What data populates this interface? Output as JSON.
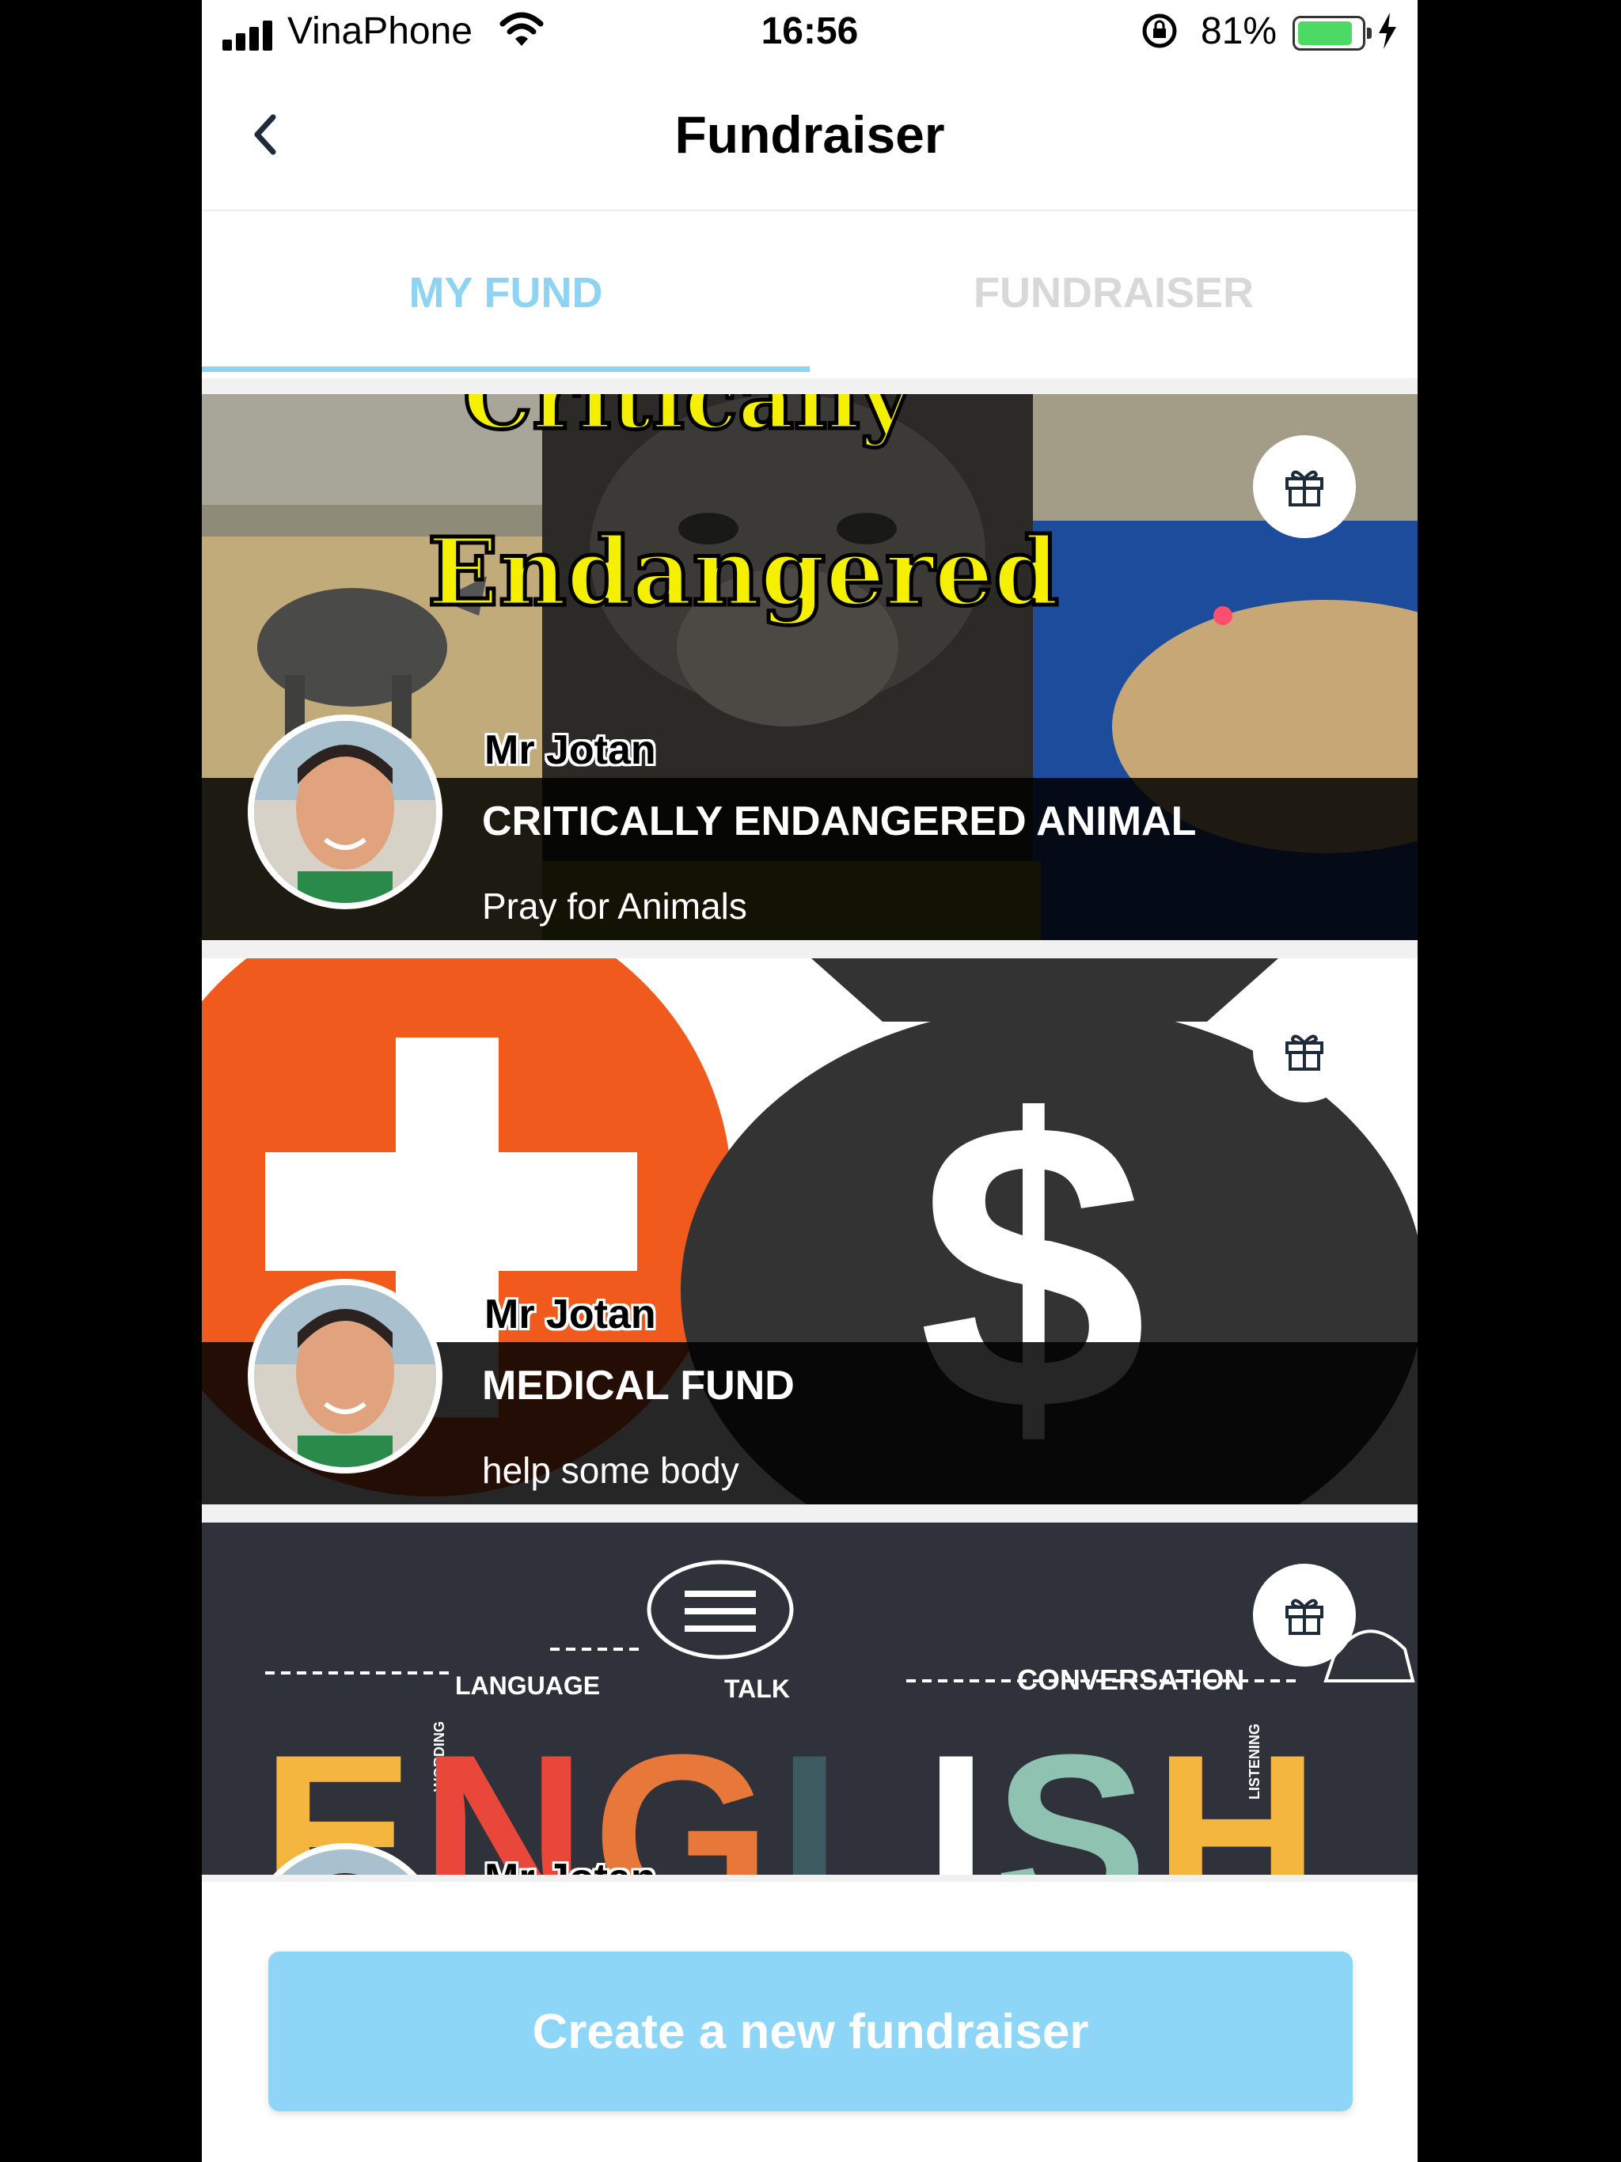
{
  "status_bar": {
    "carrier": "VinaPhone",
    "time": "16:56",
    "battery_percent": "81%",
    "battery_level": 0.81
  },
  "nav": {
    "title": "Fundraiser",
    "back_icon": "chevron-left-icon"
  },
  "tabs": [
    {
      "label": "MY FUND",
      "active": true
    },
    {
      "label": "FUNDRAISER",
      "active": false
    }
  ],
  "colors": {
    "accent": "#8dd3f4",
    "button": "#8dd6f8",
    "inactive_tab": "#d8d8d8"
  },
  "funds": [
    {
      "owner": "Mr Jotan",
      "title": "CRITICALLY ENDANGERED ANIMAL",
      "description": "Pray for Animals",
      "banner_text_1": "Critically",
      "banner_text_2": "Endangered"
    },
    {
      "owner": "Mr Jotan",
      "title": "MEDICAL FUND",
      "description": "help some body",
      "banner_symbol": "$"
    },
    {
      "owner": "Mr Jotan",
      "banner_words": [
        "LANGUAGE",
        "TALK",
        "CONVERSATION",
        "WORDING",
        "LISTENING"
      ],
      "banner_letters": [
        "E",
        "N",
        "G",
        "L",
        "I",
        "S",
        "H"
      ]
    }
  ],
  "create_button": {
    "label": "Create a new fundraiser"
  }
}
